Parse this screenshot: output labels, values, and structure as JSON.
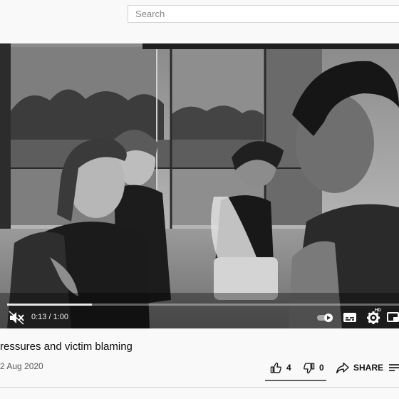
{
  "search": {
    "placeholder": "Search"
  },
  "player": {
    "current_time": "0:13",
    "duration": "1:00",
    "time_separator": "/",
    "progress": 0.217,
    "hd_label": "HD"
  },
  "video": {
    "title_fragment": "ressures and victim blaming",
    "date_fragment": "2 Aug 2020"
  },
  "actions": {
    "likes": "4",
    "dislikes": "0",
    "share_label": "SHARE"
  },
  "icons": {
    "mute": "muted-speaker-icon",
    "autoplay": "autoplay-toggle-icon",
    "subtitles": "subtitles-icon",
    "settings": "gear-icon",
    "miniplayer": "miniplayer-icon",
    "like": "thumbs-up-icon",
    "dislike": "thumbs-down-icon",
    "share": "share-arrow-icon",
    "save": "playlist-add-icon"
  }
}
